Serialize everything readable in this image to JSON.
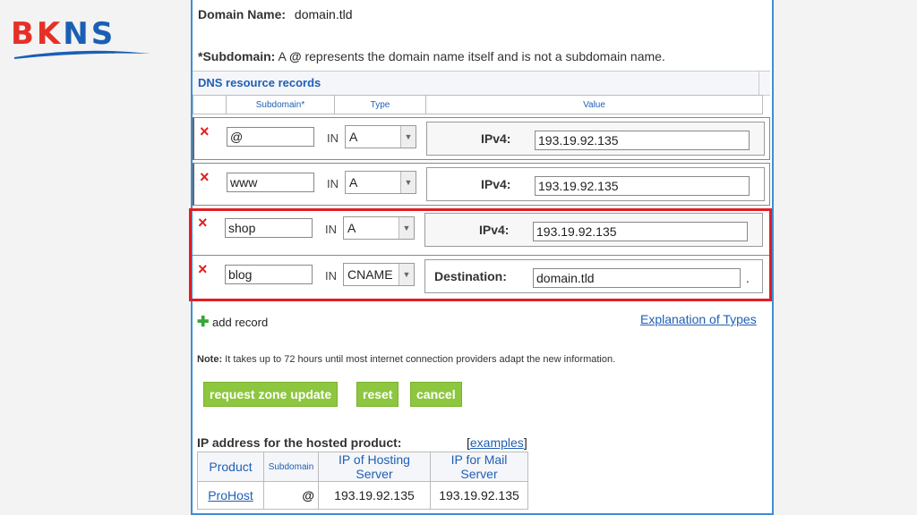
{
  "logo": {
    "part1": "BK",
    "part2": "NS"
  },
  "domain": {
    "label": "Domain Name:",
    "value": "domain.tld"
  },
  "note_subdomain": {
    "bold": "*Subdomain:",
    "text1": "A ",
    "at": "@",
    "text2": " represents the domain name itself and is not a subdomain name."
  },
  "dns": {
    "section_title": "DNS resource records",
    "columns": {
      "subdomain": "Subdomain*",
      "type": "Type",
      "value": "Value"
    },
    "in_label": "IN",
    "records": [
      {
        "subdomain": "@",
        "type": "A",
        "value_label": "IPv4:",
        "value": "193.19.92.135",
        "suffix": ""
      },
      {
        "subdomain": "www",
        "type": "A",
        "value_label": "IPv4:",
        "value": "193.19.92.135",
        "suffix": ""
      },
      {
        "subdomain": "shop",
        "type": "A",
        "value_label": "IPv4:",
        "value": "193.19.92.135",
        "suffix": ""
      },
      {
        "subdomain": "blog",
        "type": "CNAME",
        "value_label": "Destination:",
        "value": "domain.tld",
        "suffix": "."
      }
    ],
    "delete_icon": "×",
    "add_record": "add record",
    "explanation_link": "Explanation of Types"
  },
  "note": {
    "bold": "Note:",
    "text": " It takes up to 72 hours until most internet connection providers adapt the new information."
  },
  "buttons": {
    "request": "request zone update",
    "reset": "reset",
    "cancel": "cancel"
  },
  "hosted": {
    "title": "IP address for the hosted product:",
    "examples_open": "[",
    "examples": "examples",
    "examples_close": "]",
    "headers": {
      "product": "Product",
      "subdomain": "Subdomain",
      "ip_hosting": "IP of Hosting Server",
      "ip_mail": "IP for Mail Server"
    },
    "row": {
      "product": "ProHost",
      "subdomain": "@",
      "ip_hosting": "193.19.92.135",
      "ip_mail": "193.19.92.135"
    }
  },
  "colors": {
    "accent": "#3d8fd6",
    "highlight": "#e21d24",
    "button": "#8dc63f"
  }
}
